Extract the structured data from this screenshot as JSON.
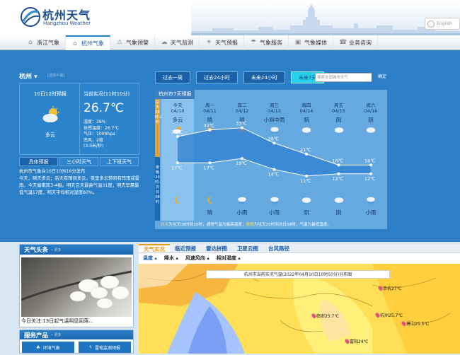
{
  "header": {
    "logo_cn": "杭州天气",
    "logo_en": "Hangzhou Weather",
    "lang": "English"
  },
  "nav": [
    {
      "label": "浙江气象",
      "icon": "home-icon",
      "active": false
    },
    {
      "label": "杭州气象",
      "icon": "home-icon",
      "active": true
    },
    {
      "label": "气象预警",
      "icon": "warning-icon",
      "active": false
    },
    {
      "label": "天气监测",
      "icon": "monitor-icon",
      "active": false
    },
    {
      "label": "天气预报",
      "icon": "forecast-icon",
      "active": false
    },
    {
      "label": "气象服务",
      "icon": "service-icon",
      "active": false
    },
    {
      "label": "气象媒体",
      "icon": "media-icon",
      "active": false
    },
    {
      "label": "业务咨询",
      "icon": "consult-icon",
      "active": false
    }
  ],
  "current": {
    "city": "杭州",
    "city_select": "[选择乡镇]",
    "forecast_title": "10日12时预报",
    "forecast_cond": "多云",
    "live_title": "当前实况(11时10分)",
    "temp": "26.7℃",
    "details": [
      "湿度：39%",
      "体感温度：26.7℃",
      "气压：1006hpa",
      "南风，2级",
      "(3.0米/秒)"
    ]
  },
  "subtabs": [
    "具体预报",
    "三小时天气",
    "上下班天气"
  ],
  "description": "杭州市气象台10日10时16分发布\n今天，晴天多云；后天有晴到多云，夜里多云转阴有阵雨或雷雨。今天偏南风3-4级。明天白天最高气温31度，明天早晨最低气温17度，明天平均相对湿度60%。",
  "range_buttons": [
    "过去一周",
    "过去24小时",
    "未来24小时",
    "未来7天"
  ],
  "search": {
    "placeholder": "搜索全国城市天气",
    "button": "确定"
  },
  "forecast": {
    "title": "杭州市7天预报",
    "day_band": "白天08时-20时",
    "night_band": "夜晚20时-次日08时",
    "days": [
      {
        "day": "今天",
        "date": "04/10",
        "day_cond": "多云",
        "day_icon": "cloud-sun-icon",
        "night_cond": "",
        "night_icon": "moon-icon",
        "high": "29℃",
        "low": "17℃"
      },
      {
        "day": "周一",
        "date": "04/11",
        "day_cond": "晴",
        "day_icon": "sun-icon",
        "night_cond": "晴",
        "night_icon": "moon-icon",
        "high": "32℃",
        "low": "17℃"
      },
      {
        "day": "周二",
        "date": "04/12",
        "day_cond": "晴",
        "day_icon": "sun-icon",
        "night_cond": "小雨",
        "night_icon": "rain-icon",
        "high": "33℃",
        "low": "19℃"
      },
      {
        "day": "周三",
        "date": "04/13",
        "day_cond": "小到中雨",
        "day_icon": "rain-icon",
        "night_cond": "小雨",
        "night_icon": "rain-icon",
        "high": "26℃",
        "low": "14℃"
      },
      {
        "day": "周四",
        "date": "04/14",
        "day_cond": "阴",
        "day_icon": "cloud-icon",
        "night_cond": "阴",
        "night_icon": "cloud-icon",
        "high": "21℃",
        "low": "11℃"
      },
      {
        "day": "周五",
        "date": "04/15",
        "day_cond": "阴",
        "day_icon": "cloud-icon",
        "night_cond": "阴",
        "night_icon": "cloud-icon",
        "high": "16℃",
        "low": "12℃"
      },
      {
        "day": "周六",
        "date": "04/16",
        "day_cond": "阴",
        "day_icon": "cloud-icon",
        "night_cond": "小雨",
        "night_icon": "rain-icon",
        "high": "16℃",
        "low": "12℃"
      }
    ],
    "high_values": [
      29,
      32,
      33,
      26,
      21,
      16,
      16
    ],
    "low_values": [
      17,
      17,
      19,
      14,
      11,
      12,
      12
    ],
    "note_a": "白天",
    "note_b": "为当天08时到20时，通常气温为最高温度；",
    "note_c": "夜晚",
    "note_d": "为当天20时到次日08时，气温为最低温度。"
  },
  "news": {
    "title": "天气头条",
    "more": "• 更多",
    "caption": "今日关注:13日起气温明显回落..."
  },
  "services": {
    "title": "服务产品",
    "more": "• 更多",
    "items": [
      "环境气象",
      "雷电监测预报"
    ]
  },
  "map": {
    "tabs": [
      "天气实况",
      "临近预报",
      "雷达拼图",
      "卫星云图",
      "台风路径"
    ],
    "subtabs": [
      "温度",
      "降水",
      "风速风向",
      "相对湿度"
    ],
    "title": "杭州市当前实况气温(2022年04月10日10时50分)分布图",
    "pins": [
      {
        "label": "余杭27℃"
      },
      {
        "label": "临安25.7℃"
      },
      {
        "label": "杭州25.7℃"
      },
      {
        "label": "萧山25.5℃"
      },
      {
        "label": "富阳24℃"
      }
    ]
  }
}
